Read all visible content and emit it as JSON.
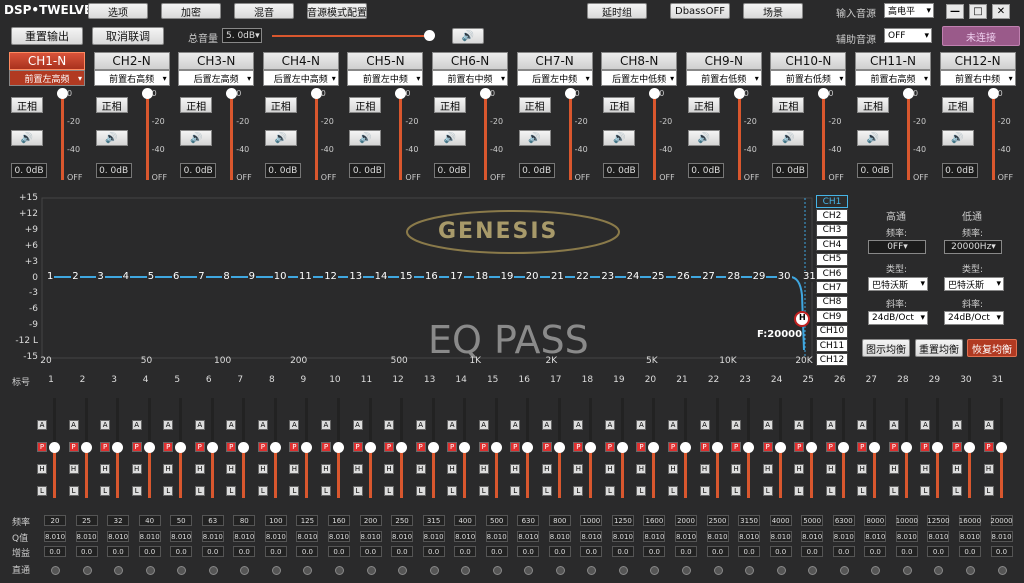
{
  "app": {
    "title": "DSP•TWELVE"
  },
  "top": {
    "b1": "选项",
    "b2": "加密",
    "b3": "混音",
    "b4": "音源模式配置",
    "b5": "延时组",
    "b6": "DbassOFF",
    "b7": "场景",
    "input_label": "输入音源",
    "input_val": "高电平",
    "aux_label": "辅助音源",
    "aux_val": "OFF",
    "connect": "未连接"
  },
  "row2": {
    "reset": "重置输出",
    "cancel": "取消联调",
    "vol_label": "总音量",
    "vol_val": "5. 0dB",
    "vol_fraction": 0.98
  },
  "channels": [
    {
      "name": "CH1-N",
      "pos": "前置左高频",
      "gain": "0. 0dB"
    },
    {
      "name": "CH2-N",
      "pos": "前置右高频",
      "gain": "0. 0dB"
    },
    {
      "name": "CH3-N",
      "pos": "后置左高频",
      "gain": "0. 0dB"
    },
    {
      "name": "CH4-N",
      "pos": "后置左中高频",
      "gain": "0. 0dB"
    },
    {
      "name": "CH5-N",
      "pos": "前置左中频",
      "gain": "0. 0dB"
    },
    {
      "name": "CH6-N",
      "pos": "前置右中频",
      "gain": "0. 0dB"
    },
    {
      "name": "CH7-N",
      "pos": "后置左中频",
      "gain": "0. 0dB"
    },
    {
      "name": "CH8-N",
      "pos": "后置左中低频",
      "gain": "0. 0dB"
    },
    {
      "name": "CH9-N",
      "pos": "前置右低频",
      "gain": "0. 0dB"
    },
    {
      "name": "CH10-N",
      "pos": "前置右低频",
      "gain": "0. 0dB"
    },
    {
      "name": "CH11-N",
      "pos": "前置右高频",
      "gain": "0. 0dB"
    },
    {
      "name": "CH12-N",
      "pos": "前置右中频",
      "gain": "0. 0dB"
    }
  ],
  "ch_common": {
    "phase": "正相",
    "ticks": [
      "0",
      "-20",
      "-40",
      "OFF"
    ]
  },
  "eq": {
    "yticks": [
      "+15",
      "+12",
      "+9",
      "+6",
      "+3",
      "0",
      "-3",
      "-6",
      "-9",
      "-12 L",
      "-15"
    ],
    "xticks": [
      "20",
      "50",
      "100",
      "200",
      "500",
      "1K",
      "2K",
      "5K",
      "10K",
      "20K"
    ],
    "logo": "GENESIS",
    "pass": "EQ PASS",
    "freq_readout": "F:20000",
    "h": "H",
    "points": [
      "1",
      "2",
      "3",
      "4",
      "5",
      "6",
      "7",
      "8",
      "9",
      "10",
      "11",
      "12",
      "13",
      "14",
      "15",
      "16",
      "17",
      "18",
      "19",
      "20",
      "21",
      "22",
      "23",
      "24",
      "25",
      "26",
      "27",
      "28",
      "29",
      "30",
      "31"
    ]
  },
  "chlist": [
    "CH1",
    "CH2",
    "CH3",
    "CH4",
    "CH5",
    "CH6",
    "CH7",
    "CH8",
    "CH9",
    "CH10",
    "CH11",
    "CH12"
  ],
  "filters": {
    "hp": "高通",
    "lp": "低通",
    "freq": "频率:",
    "hp_freq": "0FF",
    "lp_freq": "20000Hz",
    "type": "类型:",
    "hp_type": "巴特沃斯",
    "lp_type": "巴特沃斯",
    "slope": "斜率:",
    "hp_slope": "24dB/Oct",
    "lp_slope": "24dB/Oct",
    "b_graph": "图示均衡",
    "b_reset": "重置均衡",
    "b_restore": "恢复均衡"
  },
  "bands": {
    "label": "标号",
    "nums": [
      "1",
      "2",
      "3",
      "4",
      "5",
      "6",
      "7",
      "8",
      "9",
      "10",
      "11",
      "12",
      "13",
      "14",
      "15",
      "16",
      "17",
      "18",
      "19",
      "20",
      "21",
      "22",
      "23",
      "24",
      "25",
      "26",
      "27",
      "28",
      "29",
      "30",
      "31"
    ],
    "btns": [
      "A",
      "P",
      "H",
      "L"
    ]
  },
  "params": {
    "freq_label": "频率",
    "q_label": "Q值",
    "gain_label": "增益",
    "bypass_label": "直通",
    "freqs": [
      "20",
      "25",
      "32",
      "40",
      "50",
      "63",
      "80",
      "100",
      "125",
      "160",
      "200",
      "250",
      "315",
      "400",
      "500",
      "630",
      "800",
      "1000",
      "1250",
      "1600",
      "2000",
      "2500",
      "3150",
      "4000",
      "5000",
      "6300",
      "8000",
      "10000",
      "12500",
      "16000",
      "20000"
    ],
    "q": "8.010",
    "gain": "0.0"
  }
}
